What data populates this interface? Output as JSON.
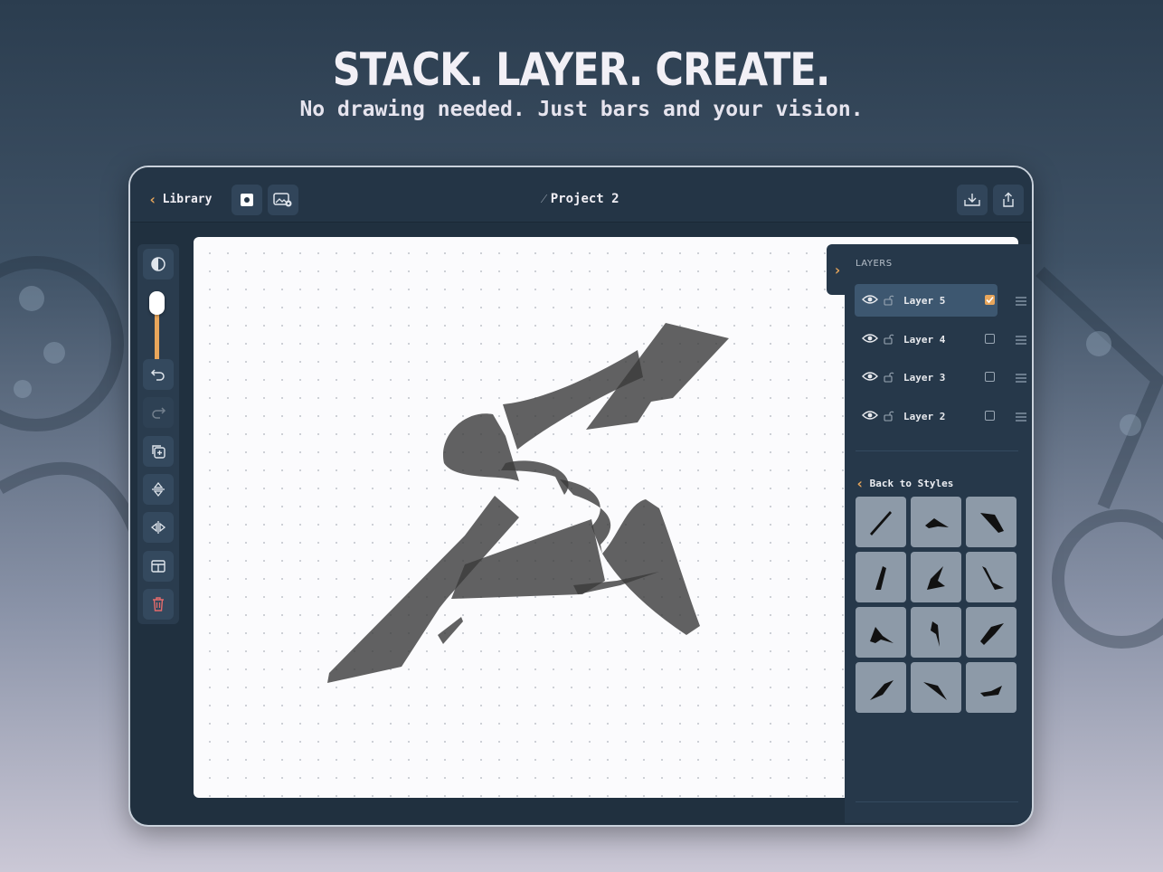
{
  "hero": {
    "title": "STACK. LAYER. CREATE.",
    "subtitle": "No drawing needed. Just bars and your vision."
  },
  "topbar": {
    "back_label": "Library",
    "project_title": "Project 2"
  },
  "layers": {
    "heading": "LAYERS",
    "items": [
      {
        "label": "Layer 5",
        "checked": true
      },
      {
        "label": "Layer 4",
        "checked": false
      },
      {
        "label": "Layer 3",
        "checked": false
      },
      {
        "label": "Layer 2",
        "checked": false
      }
    ]
  },
  "styles": {
    "back_label": "Back to Styles"
  },
  "colors": {
    "accent": "#e8a65b",
    "panel": "#26384a",
    "canvas": "#fbfbfd"
  }
}
